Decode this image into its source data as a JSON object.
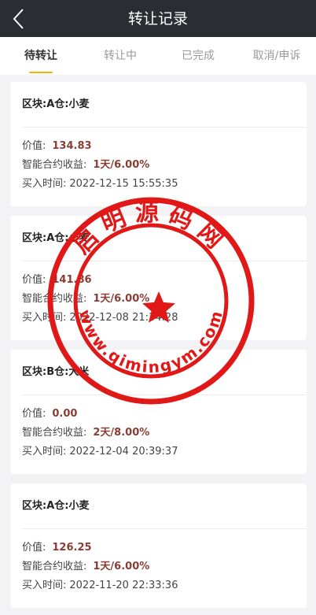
{
  "header": {
    "title": "转让记录"
  },
  "tabs": [
    {
      "label": "待转让"
    },
    {
      "label": "转让中"
    },
    {
      "label": "已完成"
    },
    {
      "label": "取消/申诉"
    }
  ],
  "labels": {
    "value": "价值:",
    "yield": "智能合约收益:",
    "time": "买入时间:"
  },
  "cards": [
    {
      "title": "区块:A仓:小麦",
      "value": "134.83",
      "yield": "1天/6.00%",
      "time": "2022-12-15 15:55:35"
    },
    {
      "title": "区块:A仓:小麦",
      "value": "141.86",
      "yield": "1天/6.00%",
      "time": "2022-12-08 21:34:28"
    },
    {
      "title": "区块:B仓:大米",
      "value": "0.00",
      "yield": "2天/8.00%",
      "time": "2022-12-04 20:39:37"
    },
    {
      "title": "区块:A仓:小麦",
      "value": "126.25",
      "yield": "1天/6.00%",
      "time": "2022-11-20 22:33:36"
    }
  ],
  "watermark": {
    "name": "启明源码网",
    "url": "www.qimingym.com",
    "color": "#e01818"
  }
}
